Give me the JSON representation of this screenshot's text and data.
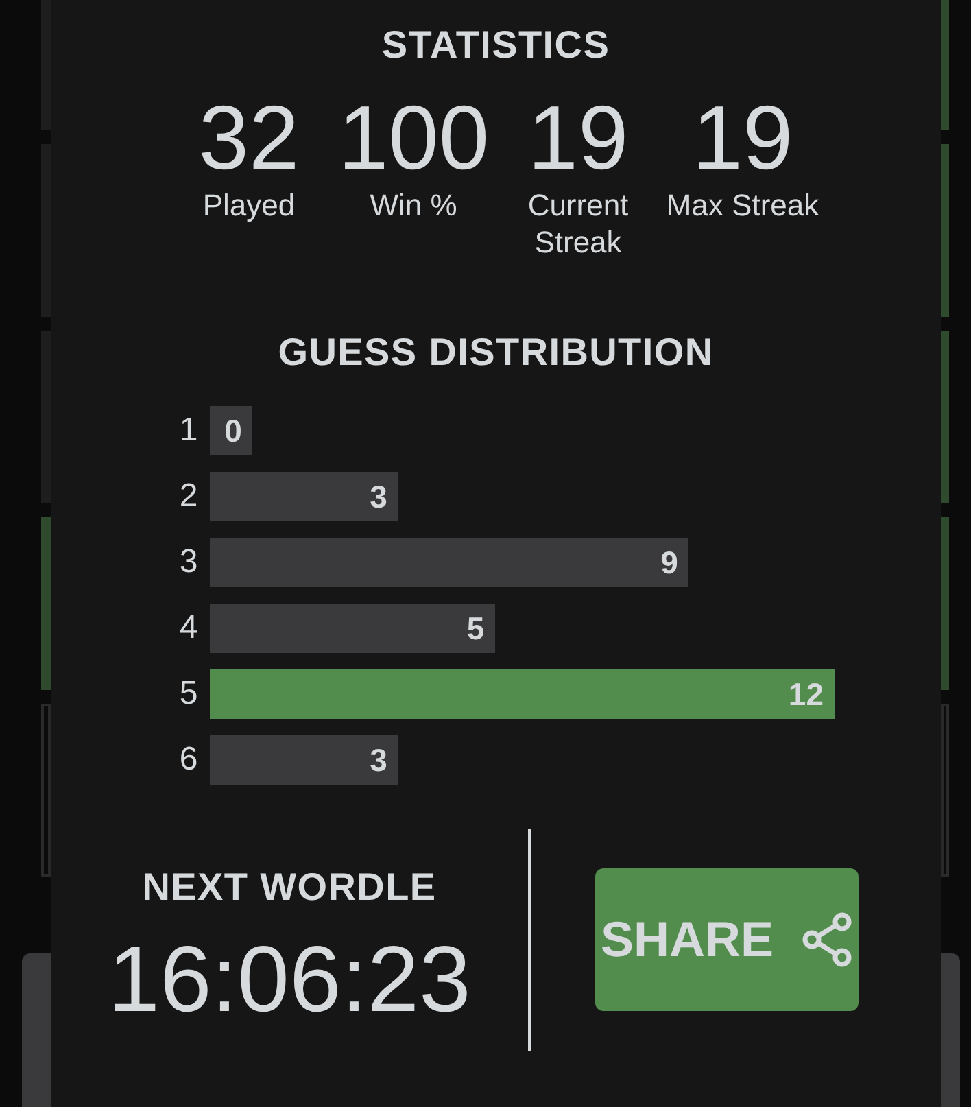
{
  "board": {
    "left_tiles": [
      {
        "color": "#1e1e1e"
      },
      {
        "color": "#1e1e1e"
      },
      {
        "color": "#1e1e1e"
      },
      {
        "color": "#2f4a2c"
      },
      {
        "color": "#2a2a2a",
        "kind": "empty"
      }
    ],
    "right_tiles": [
      {
        "color": "#2f4a2c"
      },
      {
        "color": "#2f4a2c"
      },
      {
        "color": "#2f4a2c"
      },
      {
        "color": "#2f4a2c"
      },
      {
        "color": "#2a2a2a",
        "kind": "empty"
      }
    ]
  },
  "statistics": {
    "title": "STATISTICS",
    "stats": [
      {
        "value": "32",
        "label": "Played"
      },
      {
        "value": "100",
        "label": "Win %"
      },
      {
        "value": "19",
        "label": "Current Streak"
      },
      {
        "value": "19",
        "label": "Max Streak"
      }
    ]
  },
  "guess_distribution": {
    "title": "GUESS DISTRIBUTION",
    "rows": [
      {
        "guess": "1",
        "count": "0",
        "selected": false
      },
      {
        "guess": "2",
        "count": "3",
        "selected": false
      },
      {
        "guess": "3",
        "count": "9",
        "selected": false
      },
      {
        "guess": "4",
        "count": "5",
        "selected": false
      },
      {
        "guess": "5",
        "count": "12",
        "selected": true
      },
      {
        "guess": "6",
        "count": "3",
        "selected": false
      }
    ]
  },
  "next_wordle": {
    "title": "NEXT WORDLE",
    "timer": "16:06:23"
  },
  "share_button": {
    "label": "SHARE"
  }
}
